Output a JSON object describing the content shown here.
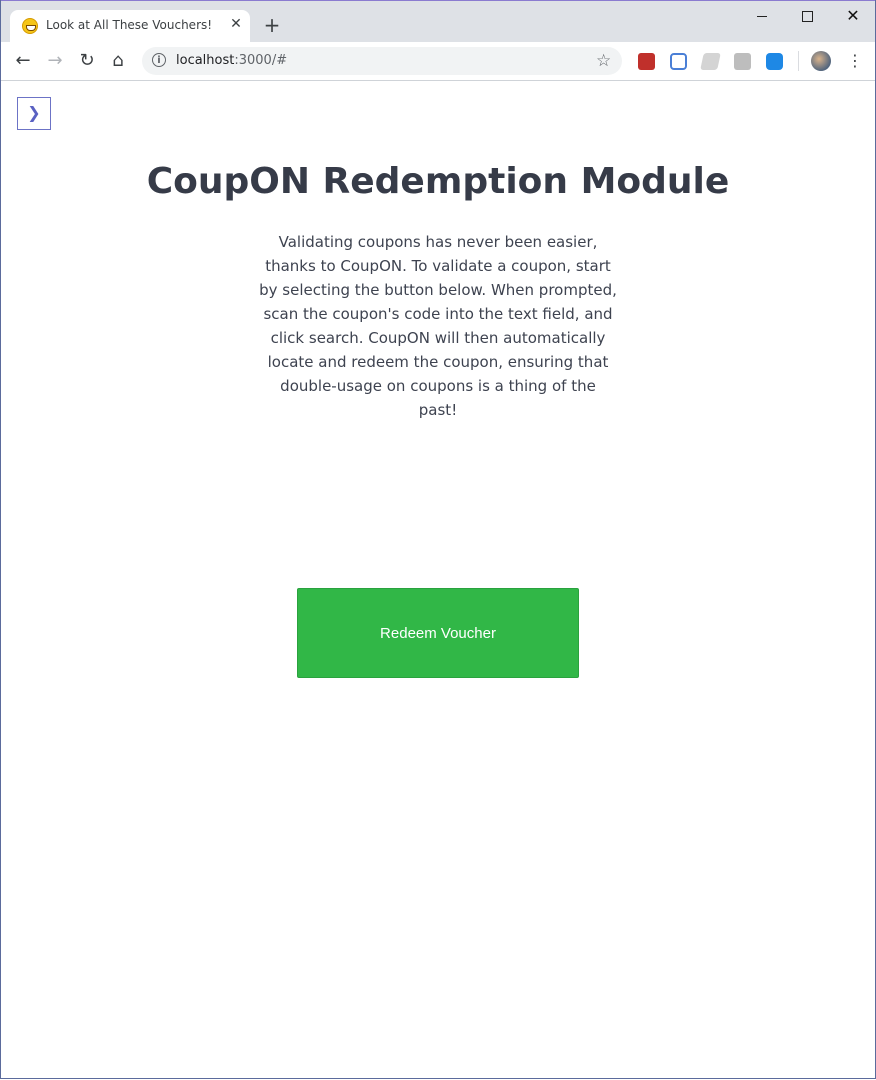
{
  "browser": {
    "tab_title": "Look at All These Vouchers!",
    "tab_close": "✕",
    "new_tab": "+",
    "url_host": "localhost",
    "url_rest": ":3000/#",
    "window_close": "✕"
  },
  "icons": {
    "back": "←",
    "forward": "→",
    "reload": "↻",
    "home": "⌂",
    "info": "i",
    "star": "☆",
    "menu": "⋮",
    "sidebar_toggle": "❯"
  },
  "page": {
    "title": "CoupON Redemption Module",
    "intro": "Validating coupons has never been easier, thanks to CoupON. To validate a coupon, start by selecting the button below. When prompted, scan the coupon's code into the text field, and click search. CoupON will then automatically locate and redeem the coupon, ensuring that double-usage on coupons is a thing of the past!",
    "redeem_button": "Redeem Voucher"
  },
  "colors": {
    "accent_button": "#31b747",
    "title_text": "#363b48",
    "toggle_border": "#6c73c6"
  }
}
